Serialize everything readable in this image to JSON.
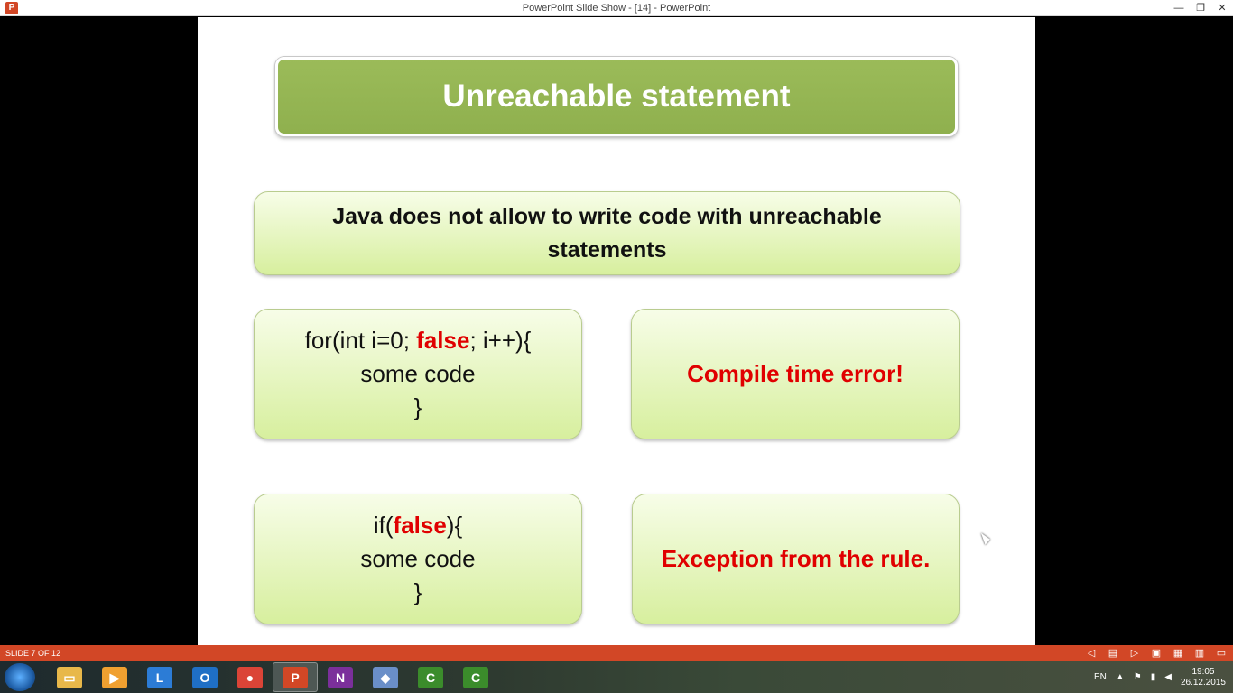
{
  "window": {
    "title": "PowerPoint Slide Show - [14] - PowerPoint",
    "app_icon_letter": "P",
    "controls": [
      "—",
      "❐",
      "✕"
    ]
  },
  "slide": {
    "title": "Unreachable statement",
    "intro": "Java does not allow to write code with unreachable statements",
    "example1": {
      "line1_prefix": "for(int i=0; ",
      "line1_keyword": "false",
      "line1_suffix": "; i++){",
      "line2": "some code",
      "line3": "}"
    },
    "example2": {
      "line1_prefix": "if(",
      "line1_keyword": "false",
      "line1_suffix": "){",
      "line2": "some code",
      "line3": "}"
    },
    "result1": "Compile time error!",
    "result2": "Exception from the rule."
  },
  "statusbar": {
    "slide_counter": "SLIDE 7 OF 12",
    "icons": [
      "prev-icon",
      "notes-icon",
      "next-icon",
      "normal-view-icon",
      "slide-sorter-icon",
      "reading-view-icon",
      "slideshow-icon"
    ]
  },
  "taskbar": {
    "apps": [
      {
        "name": "file-explorer",
        "glyph": "▭",
        "color": "#e8b84a"
      },
      {
        "name": "media-player",
        "glyph": "▶",
        "color": "#f0a030"
      },
      {
        "name": "lync",
        "glyph": "L",
        "color": "#2c7cd6"
      },
      {
        "name": "outlook",
        "glyph": "O",
        "color": "#1f6fc5"
      },
      {
        "name": "chrome",
        "glyph": "●",
        "color": "#db4437"
      },
      {
        "name": "powerpoint",
        "glyph": "P",
        "color": "#d24726"
      },
      {
        "name": "onenote",
        "glyph": "N",
        "color": "#7b2f9b"
      },
      {
        "name": "virtualbox",
        "glyph": "◆",
        "color": "#6a8fc8"
      },
      {
        "name": "camtasia-1",
        "glyph": "C",
        "color": "#3b8c2b"
      },
      {
        "name": "camtasia-2",
        "glyph": "C",
        "color": "#3b8c2b"
      }
    ],
    "tray": {
      "language": "EN",
      "time": "19:05",
      "date": "26.12.2015"
    }
  },
  "colors": {
    "accent": "#d24726",
    "title_green": "#9bbb59",
    "error_red": "#e00000"
  }
}
